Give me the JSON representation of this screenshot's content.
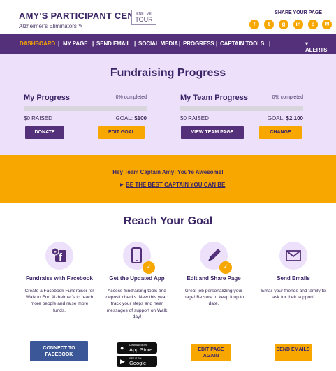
{
  "header": {
    "title": "AMY'S PARTICIPANT CENTER",
    "team": "Alzheimer's Eliminators",
    "tour_top": "ENE · VE",
    "tour_label": "TOUR",
    "share_label": "SHARE YOUR PAGE",
    "social": [
      "facebook-icon",
      "twitter-icon",
      "googleplus-icon",
      "linkedin-icon",
      "pinterest-icon",
      "email-icon"
    ]
  },
  "nav": {
    "items": [
      "DASHBOARD",
      "MY PAGE",
      "SEND EMAIL",
      "SOCIAL MEDIA",
      "PROGRESS",
      "CAPTAIN TOOLS"
    ],
    "alerts": "ALERTS"
  },
  "progress": {
    "heading": "Fundraising Progress",
    "mine": {
      "title": "My Progress",
      "pct": "0% completed",
      "raised": "$0 RAISED",
      "goal_label": "GOAL:",
      "goal": "$100",
      "fill": 0,
      "btn1": "DONATE",
      "btn2": "EDIT GOAL"
    },
    "team": {
      "title": "My Team Progress",
      "pct": "0% completed",
      "raised": "$0 RAISED",
      "goal_label": "GOAL:",
      "goal": "$2,100",
      "fill": 0,
      "btn1": "VIEW TEAM PAGE",
      "btn2": "CHANGE"
    }
  },
  "banner": {
    "message": "Hey Team Captain Amy! You're Awesome!",
    "link": "BE THE BEST CAPTAIN YOU CAN BE"
  },
  "reach": {
    "heading": "Reach Your Goal",
    "cards": [
      {
        "title": "Fundraise with Facebook",
        "text": "Create a Facebook Fundraiser for Walk to End Alzheimer's to reach more people and raise more funds.",
        "button": "CONNECT TO FACEBOOK"
      },
      {
        "title": "Get the Updated App",
        "text": "Access fundraising tools and deposit checks. New this year: track your steps and hear messages of support on Walk day!",
        "appstore_small": "Download on the",
        "appstore": "App Store",
        "gplay_small": "GET IT ON",
        "gplay": "Google Play"
      },
      {
        "title": "Edit and Share Page",
        "text": "Great job personalizing your page! Be sure to keep it up to date.",
        "button": "EDIT PAGE AGAIN"
      },
      {
        "title": "Send Emails",
        "text": "Email your friends and family to ask for their support!",
        "button": "SEND EMAILS"
      }
    ]
  },
  "colors": {
    "purple": "#55307a",
    "orange": "#f7a700",
    "lavender": "#ece0fb",
    "facebook": "#3b5798"
  }
}
